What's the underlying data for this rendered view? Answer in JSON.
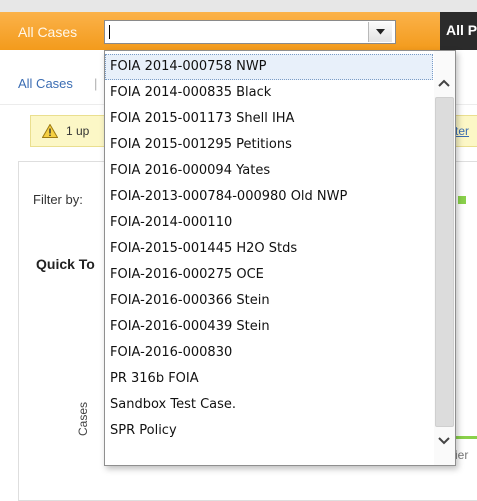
{
  "header": {
    "tab_all_cases": "All Cases",
    "tab_all_p": "All P"
  },
  "select": {
    "value": ""
  },
  "breadcrumb": {
    "label": "All Cases",
    "separator": "|"
  },
  "notice": {
    "text": "1 up",
    "link_text": "ter"
  },
  "filter": {
    "label": "Filter by:"
  },
  "quick": {
    "title": "Quick To"
  },
  "chart": {
    "ylabel": "Cases",
    "legend_fragment": "ier"
  },
  "dropdown": {
    "items": [
      "FOIA 2014-000758 NWP",
      "FOIA 2014-000835 Black",
      "FOIA 2015-001173 Shell IHA",
      "FOIA 2015-001295 Petitions",
      "FOIA 2016-000094 Yates",
      "FOIA-2013-000784-000980 Old NWP",
      "FOIA-2014-000110",
      "FOIA-2015-001445 H2O Stds",
      "FOIA-2016-000275 OCE",
      "FOIA-2016-000366 Stein",
      "FOIA-2016-000439 Stein",
      "FOIA-2016-000830",
      "PR 316b FOIA",
      "Sandbox Test Case.",
      "SPR Policy"
    ],
    "selected_index": 0
  },
  "colors": {
    "header_orange": "#f39b1c",
    "header_dark": "#2b2b2b",
    "link_blue": "#3b6db3",
    "notice_bg": "#fcf7c6",
    "accent_green": "#8ad14b"
  },
  "icons": {
    "select_arrow": "chevron-down-icon",
    "warning": "warning-icon",
    "scroll_up": "chevron-up-icon",
    "scroll_down": "chevron-down-icon"
  }
}
